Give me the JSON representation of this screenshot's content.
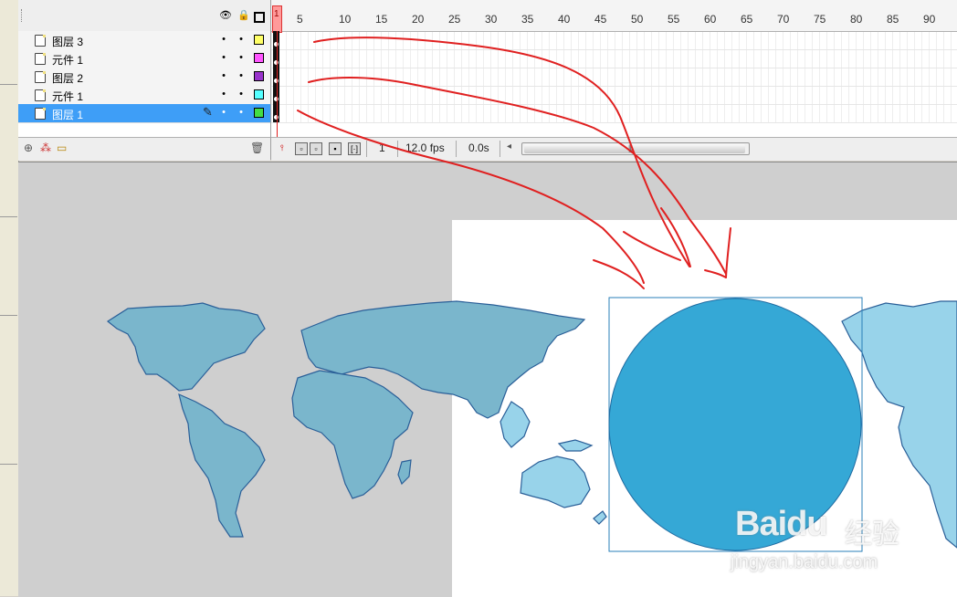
{
  "timeline": {
    "layers": [
      {
        "name": "图层 3",
        "color": "#ffff66",
        "selected": false
      },
      {
        "name": "元件 1",
        "color": "#ff55ff",
        "selected": false
      },
      {
        "name": "图层 2",
        "color": "#9933cc",
        "selected": false
      },
      {
        "name": "元件 1",
        "color": "#55ffff",
        "selected": false
      },
      {
        "name": "图层 1",
        "color": "#44dd44",
        "selected": true
      }
    ],
    "ruler_labels": [
      "1",
      "5",
      "10",
      "15",
      "20",
      "25",
      "30",
      "35",
      "40",
      "45",
      "50",
      "55",
      "60",
      "65",
      "70",
      "75",
      "80",
      "85",
      "90"
    ],
    "current_frame": "1",
    "frame_rate": "12.0 fps",
    "elapsed_time": "0.0s",
    "header_icons": [
      "eye-icon",
      "lock-icon",
      "outline-icon"
    ],
    "layer_tools": [
      "insert-layer-icon",
      "add-motion-guide-icon",
      "insert-folder-icon",
      "delete-layer-icon"
    ]
  },
  "stage": {
    "stage_color": "#ffffff",
    "workspace_color": "#cfcfcf",
    "map_color": "#98d3ea",
    "map_dim_color": "#7ab6cc",
    "map_stroke": "#2a5f98",
    "circle_fill": "#35a8d6",
    "circle_stroke": "#1f6aa0",
    "selection_box_color": "#2a7fb8",
    "annotation_color": "#e02020"
  },
  "watermark": {
    "logo_text": "Baidu",
    "cn_text": "经验",
    "url_text": "jingyan.baidu.com"
  }
}
